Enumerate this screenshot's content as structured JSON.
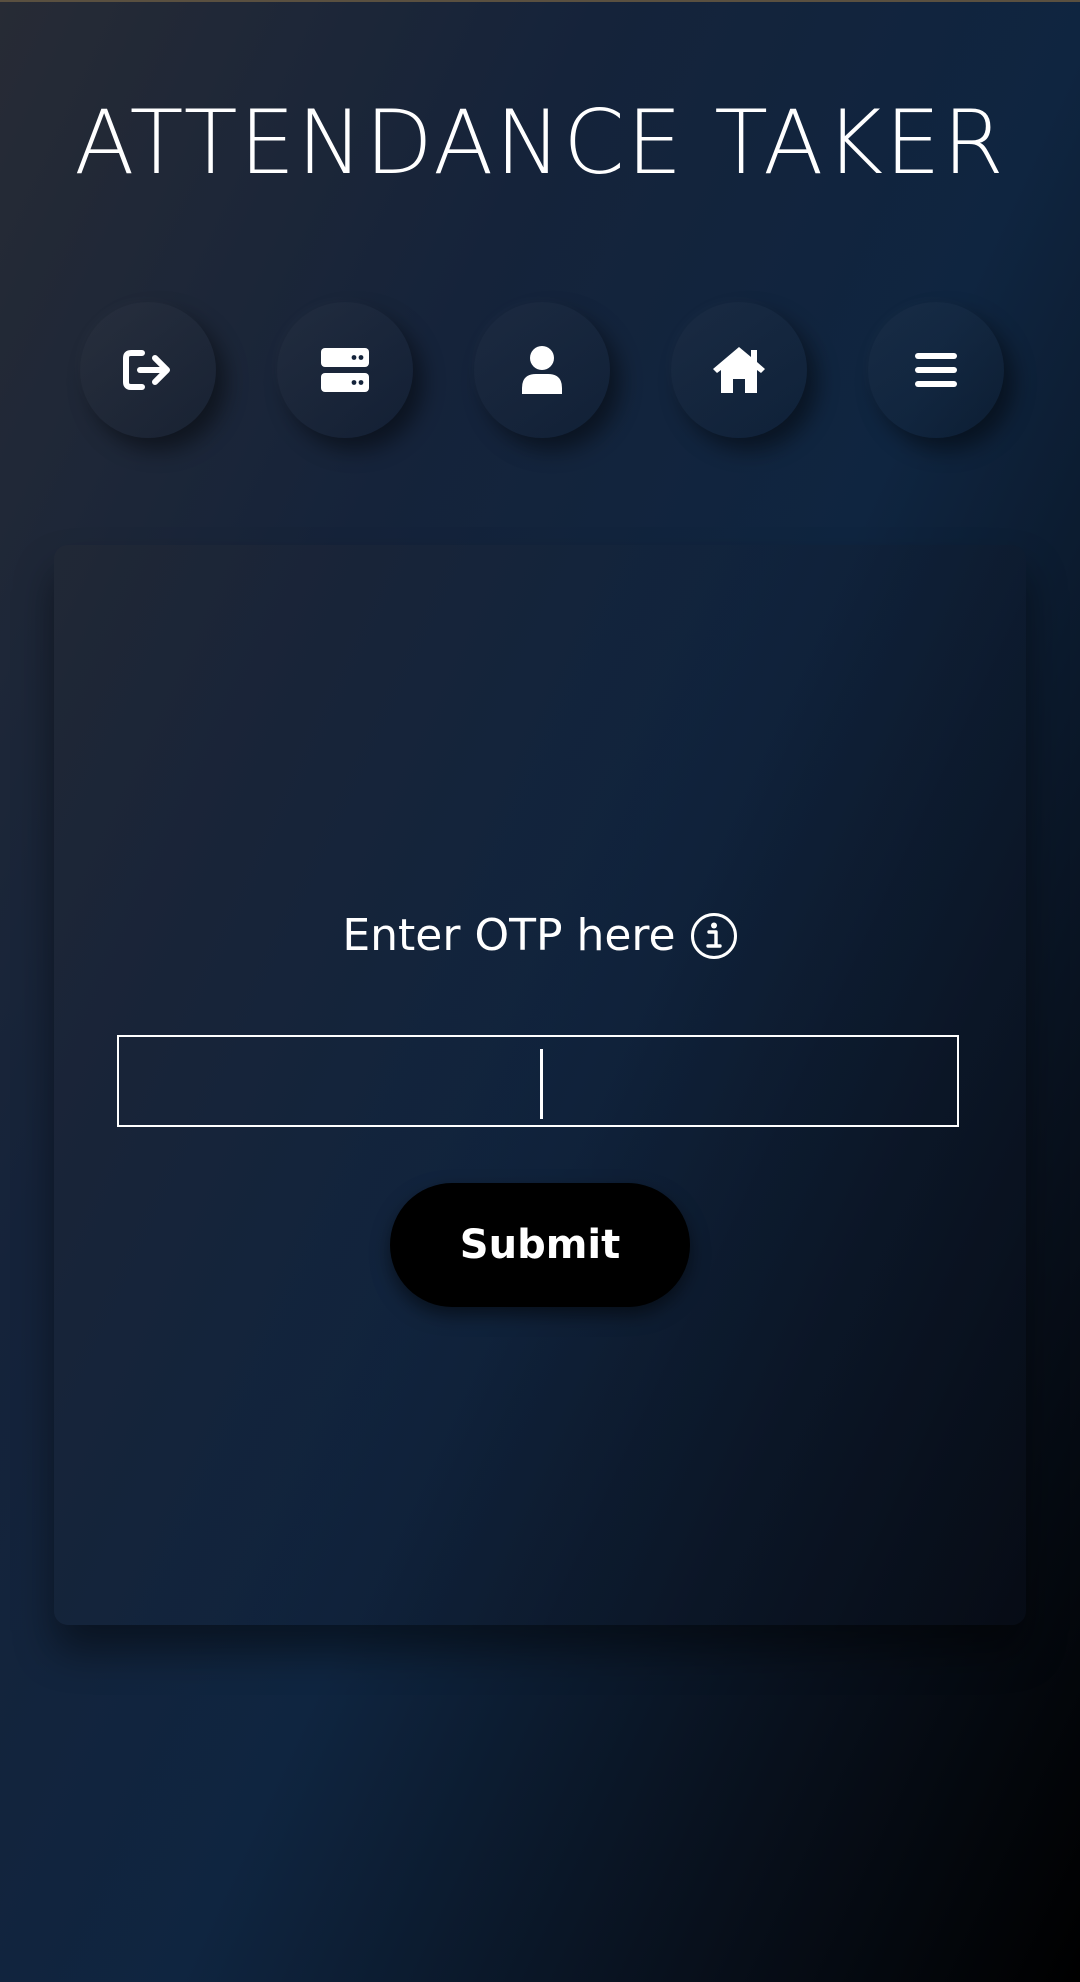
{
  "header": {
    "title": "ATTENDANCE TAKER"
  },
  "nav": {
    "items": [
      {
        "icon": "logout-icon",
        "name": "logout"
      },
      {
        "icon": "server-icon",
        "name": "records"
      },
      {
        "icon": "user-icon",
        "name": "profile"
      },
      {
        "icon": "home-icon",
        "name": "home"
      },
      {
        "icon": "menu-icon",
        "name": "menu"
      }
    ]
  },
  "otp_form": {
    "label": "Enter OTP here",
    "info_icon": "info-circle-icon",
    "input_value": "",
    "input_placeholder": "",
    "submit_label": "Submit"
  },
  "colors": {
    "text": "#ffffff",
    "button_bg": "#000000"
  }
}
